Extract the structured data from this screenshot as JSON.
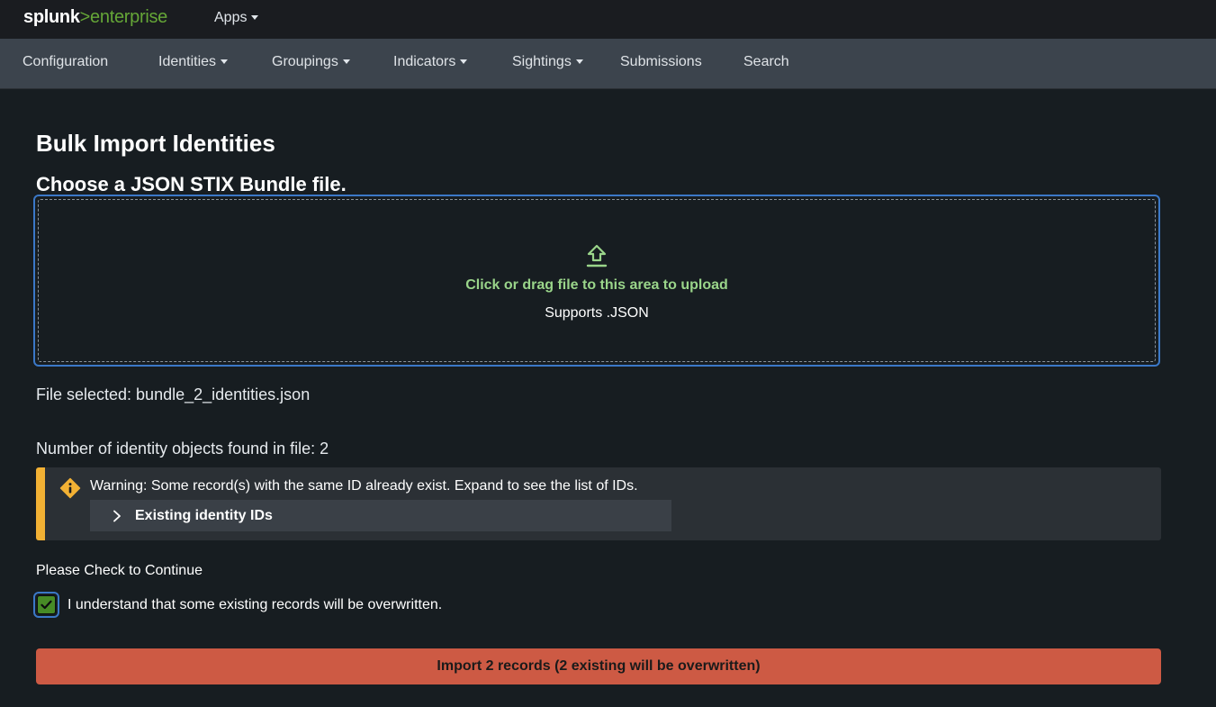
{
  "header": {
    "logo_brand": "splunk",
    "logo_separator": ">",
    "logo_product": "enterprise",
    "apps_label": "Apps"
  },
  "nav": {
    "configuration": "Configuration",
    "identities": "Identities",
    "groupings": "Groupings",
    "indicators": "Indicators",
    "sightings": "Sightings",
    "submissions": "Submissions",
    "search": "Search"
  },
  "main": {
    "title": "Bulk Import Identities",
    "subtitle": "Choose a JSON STIX Bundle file.",
    "dropzone": {
      "icon": "upload-icon",
      "primary_text": "Click or drag file to this area to upload",
      "secondary_text": "Supports .JSON"
    },
    "file_selected": "File selected: bundle_2_identities.json",
    "objects_found": "Number of identity objects found in file: 2",
    "warning": {
      "icon": "warning-icon",
      "message": "Warning: Some record(s) with the same ID already exist. Expand to see the list of IDs.",
      "expander_label": "Existing identity IDs",
      "expanded": false
    },
    "check_prompt": "Please Check to Continue",
    "checkbox": {
      "label": "I understand that some existing records will be overwritten.",
      "checked": true
    },
    "import_button": "Import 2 records (2 existing will be overwritten)"
  },
  "colors": {
    "background": "#171d21",
    "navbar": "#3c444d",
    "accent_green": "#65a637",
    "upload_text": "#9ad58a",
    "focus_blue": "#3b78c7",
    "warning_yellow": "#f2b134",
    "danger_button": "#cd5a44"
  }
}
